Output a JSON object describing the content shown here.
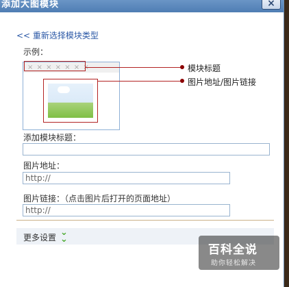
{
  "dialog": {
    "title": "添加大图模块",
    "close_glyph": "×"
  },
  "back_link": "<< 重新选择模块类型",
  "example": {
    "label": "示例：",
    "title_placeholder": "× × × × × × ×",
    "callouts": [
      "模块标题",
      "图片地址/图片链接"
    ]
  },
  "form": {
    "title_label": "添加模块标题：",
    "title_value": "",
    "image_url_label": "图片地址：",
    "image_url_value": "http://",
    "image_link_label": "图片链接：（点击图片后打开的页面地址）",
    "image_link_value": "http://"
  },
  "more_settings": {
    "label": "更多设置",
    "icon": "double-chevron-down-icon"
  },
  "watermark": {
    "title": "百科全说",
    "subtitle": "助你轻松解决"
  },
  "colors": {
    "link": "#2b58a6",
    "highlight": "#b22222",
    "chevron": "#4caa2f"
  }
}
